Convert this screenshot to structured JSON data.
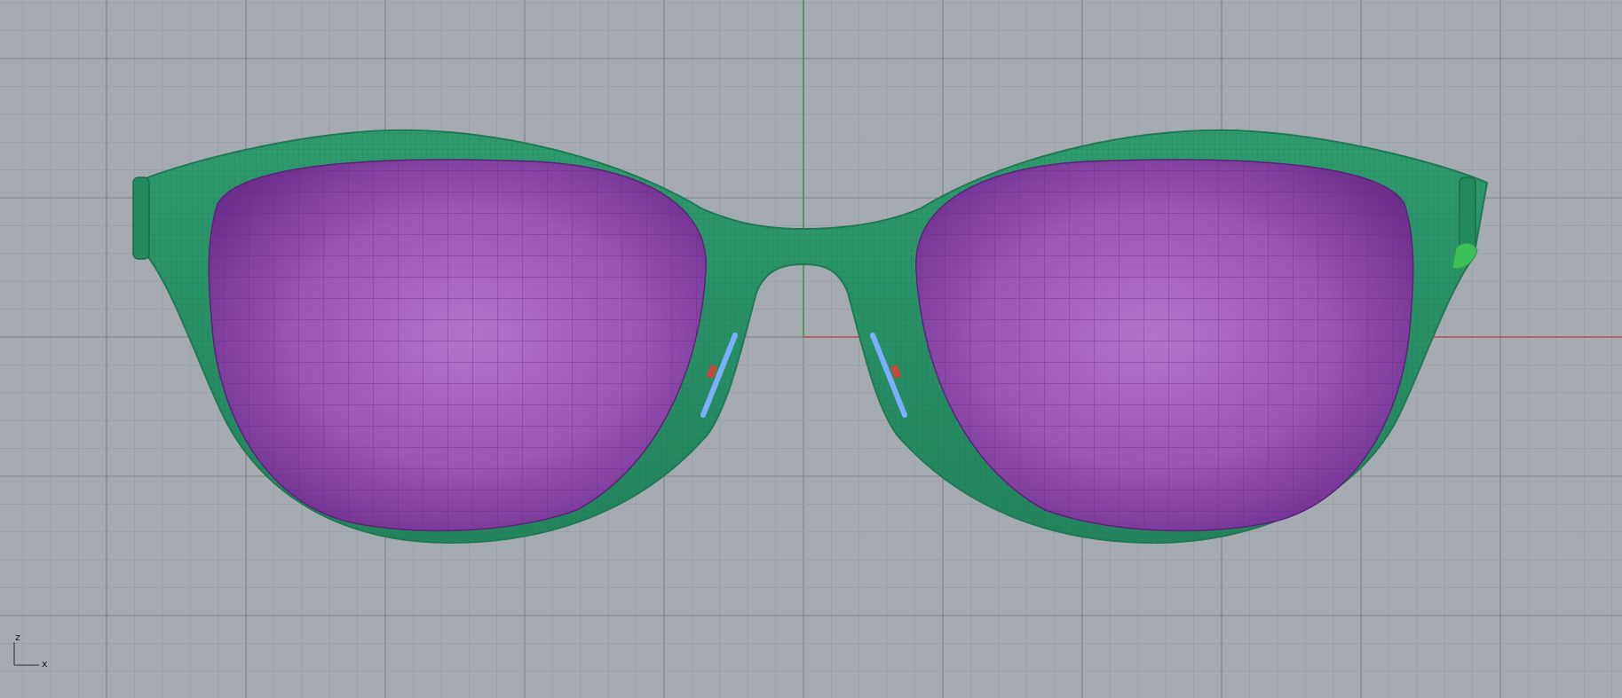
{
  "viewport": {
    "view": "Front",
    "background_color": "#a6aab1",
    "grid_minor_color": "#999ea6",
    "grid_major_color": "#7c8088",
    "x_axis_color": "#b84a4a",
    "z_axis_color": "#3f8f3f"
  },
  "axis_widget": {
    "vertical_label": "z",
    "horizontal_label": "x"
  },
  "model": {
    "frame_color": "#2a9268",
    "frame_edge_color": "#1f7a55",
    "frame_mesh_color": "#15724e",
    "lens_color": "#9a55b5",
    "lens_dark_color": "#6e2f8f",
    "lens_mesh_color": "#6b2a8b",
    "nose_pad_color": "#6fa9ff",
    "nose_pad_pin_color": "#c24a3a",
    "temple_end_color": "#3fbf58"
  }
}
